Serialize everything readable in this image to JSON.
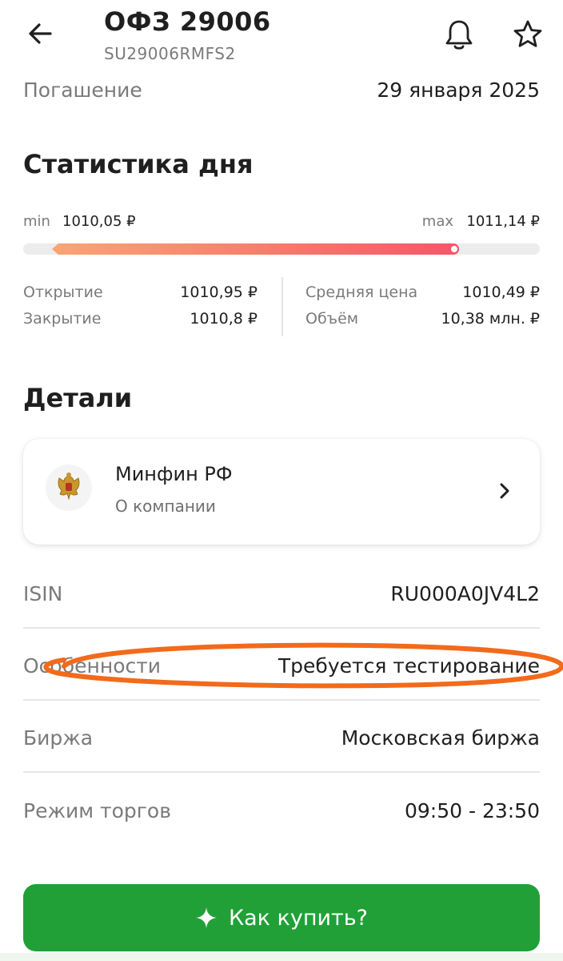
{
  "header": {
    "title": "ОФЗ 29006",
    "subtitle": "SU29006RMFS2",
    "icons": {
      "back": "arrow-left-icon",
      "bell": "bell-icon",
      "star": "star-icon"
    }
  },
  "maturity": {
    "label": "Погашение",
    "value": "29 января 2025"
  },
  "day_stats": {
    "title": "Статистика дня",
    "min_label": "min",
    "min_value": "1010,05 ₽",
    "max_label": "max",
    "max_value": "1011,14 ₽",
    "range_fill_fraction": 0.82,
    "open_label": "Открытие",
    "open_value": "1010,95 ₽",
    "close_label": "Закрытие",
    "close_value": "1010,8 ₽",
    "avg_label": "Средняя цена",
    "avg_value": "1010,49 ₽",
    "volume_label": "Объём",
    "volume_value": "10,38 млн. ₽"
  },
  "details": {
    "title": "Детали",
    "company": {
      "name": "Минфин РФ",
      "link_text": "О компании",
      "icon": "coat-of-arms-icon"
    },
    "rows": [
      {
        "label": "ISIN",
        "value": "RU000A0JV4L2"
      },
      {
        "label": "Особенности",
        "value": "Требуется тестирование"
      },
      {
        "label": "Биржа",
        "value": "Московская биржа"
      },
      {
        "label": "Режим торгов",
        "value": "09:50 - 23:50"
      }
    ]
  },
  "buy_button": {
    "label": "Как купить?",
    "icon": "sparkle-icon"
  },
  "colors": {
    "accent_green": "#21a038",
    "range_start": "#f8a476",
    "range_end": "#f3576a",
    "annotation": "#f26a1b"
  }
}
